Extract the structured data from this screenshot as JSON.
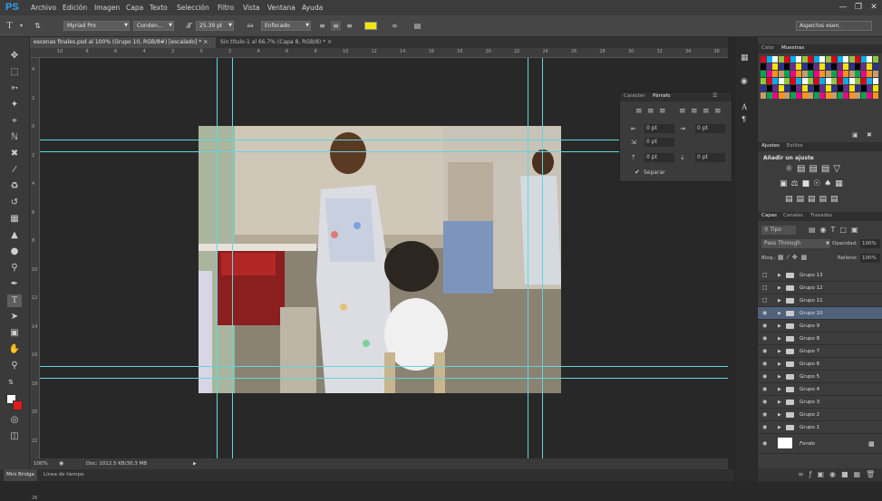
{
  "app": {
    "logo": "PS"
  },
  "menu": [
    "Archivo",
    "Edición",
    "Imagen",
    "Capa",
    "Texto",
    "Selección",
    "Filtro",
    "Vista",
    "Ventana",
    "Ayuda"
  ],
  "workspace": "Aspectos esen.",
  "options": {
    "font_family": "Myriad Pro",
    "font_style": "Conden...",
    "font_size": "25.39 pt",
    "antialias_label": "aa",
    "antialias": "Enfocado",
    "text_color": "#f5e600"
  },
  "tabs": [
    {
      "label": "escenas finales.psd al 100% (Grupo 10, RGB/8#) [escalado] *",
      "close": "×"
    },
    {
      "label": "Sin título-1 al 66.7% (Capa 8, RGB/8) *",
      "close": "×"
    }
  ],
  "ruler_h": [
    "10",
    "8",
    "6",
    "4",
    "2",
    "0",
    "2",
    "4",
    "6",
    "8",
    "10",
    "12",
    "14",
    "16",
    "18",
    "20",
    "22",
    "24",
    "26",
    "28",
    "30",
    "32",
    "34",
    "36"
  ],
  "ruler_v": [
    "4",
    "2",
    "0",
    "2",
    "4",
    "6",
    "8",
    "10",
    "12",
    "14",
    "16",
    "18",
    "20",
    "22",
    "24",
    "26"
  ],
  "status": {
    "zoom": "100%",
    "doc": "Doc: 1012.5 KB/30.3 MB"
  },
  "bottom_tabs": [
    "Mini Bridge",
    "Línea de tiempo"
  ],
  "paragraph_panel": {
    "tabs": [
      "Carácter",
      "Párrafo"
    ],
    "indent_left": "0 pt",
    "indent_first": "0 pt",
    "indent_right": "0 pt",
    "space_before": "0 pt",
    "space_after": "0 pt",
    "hyphenate_label": "Separar",
    "hyphenate_checked": true
  },
  "color_panel": {
    "tabs": [
      "Color",
      "Muestras"
    ]
  },
  "adjust_panel": {
    "tabs": [
      "Ajustes",
      "Estilos"
    ],
    "title": "Añadir un ajuste"
  },
  "layers_panel": {
    "tabs": [
      "Capas",
      "Canales",
      "Trazados"
    ],
    "filter": "Tipo",
    "blend_mode": "Pass Through",
    "opacity_label": "Opacidad:",
    "opacity": "100%",
    "lock_label": "Bloq.:",
    "fill_label": "Relleno:",
    "fill": "100%",
    "layers": [
      {
        "name": "Grupo 13",
        "visible": false,
        "selected": false
      },
      {
        "name": "Grupo 12",
        "visible": false,
        "selected": false
      },
      {
        "name": "Grupo 11",
        "visible": false,
        "selected": false
      },
      {
        "name": "Grupo 10",
        "visible": true,
        "selected": true
      },
      {
        "name": "Grupo 9",
        "visible": true,
        "selected": false
      },
      {
        "name": "Grupo 8",
        "visible": true,
        "selected": false
      },
      {
        "name": "Grupo 7",
        "visible": true,
        "selected": false
      },
      {
        "name": "Grupo 6",
        "visible": true,
        "selected": false
      },
      {
        "name": "Grupo 5",
        "visible": true,
        "selected": false
      },
      {
        "name": "Grupo 4",
        "visible": true,
        "selected": false
      },
      {
        "name": "Grupo 3",
        "visible": true,
        "selected": false
      },
      {
        "name": "Grupo 2",
        "visible": true,
        "selected": false
      },
      {
        "name": "Grupo 1",
        "visible": true,
        "selected": false
      }
    ],
    "background": "Fondo"
  },
  "colors": {
    "foreground": "#ffffff",
    "background": "#e01b1b",
    "guide": "#5fd6df",
    "selected_layer": "#50617a"
  }
}
